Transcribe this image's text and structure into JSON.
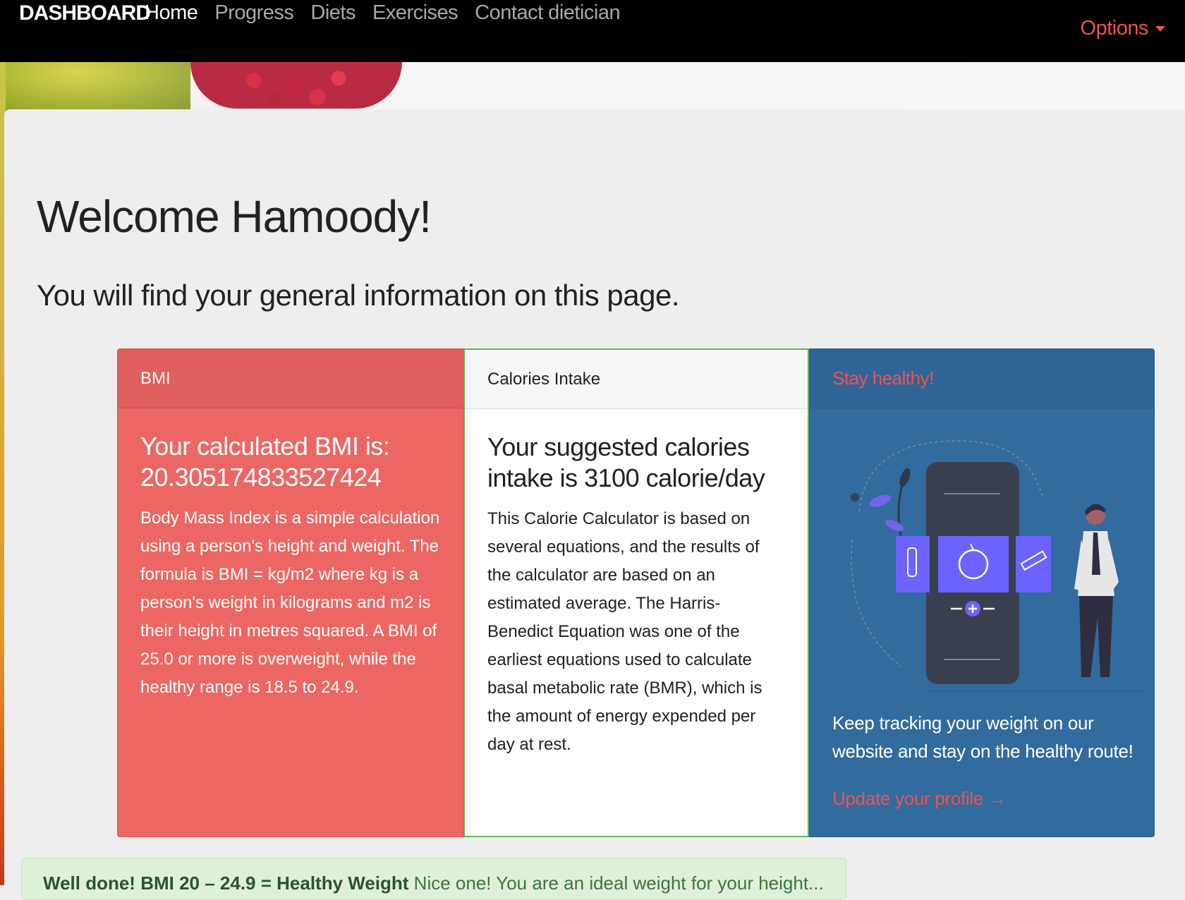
{
  "nav": {
    "brand": "DASHBOARD",
    "items": [
      {
        "label": "Home",
        "active": true
      },
      {
        "label": "Progress",
        "active": false
      },
      {
        "label": "Diets",
        "active": false
      },
      {
        "label": "Exercises",
        "active": false
      },
      {
        "label": "Contact dietician",
        "active": false
      }
    ],
    "options_label": "Options"
  },
  "main": {
    "welcome": "Welcome Hamoody!",
    "subtitle": "You will find your general information on this page."
  },
  "cards": {
    "bmi": {
      "header": "BMI",
      "title": "Your calculated BMI is: 20.305174833527424",
      "text": "Body Mass Index is a simple calculation using a person's height and weight. The formula is BMI = kg/m2 where kg is a person's weight in kilograms and m2 is their height in metres squared. A BMI of 25.0 or more is overweight, while the healthy range is 18.5 to 24.9."
    },
    "calories": {
      "header": "Calories Intake",
      "title": "Your suggested calories intake is 3100 calorie/day",
      "text": "This Calorie Calculator is based on several equations, and the results of the calculator are based on an estimated average. The Harris-Benedict Equation was one of the earliest equations used to calculate basal metabolic rate (BMR), which is the amount of energy expended per day at rest."
    },
    "health": {
      "header": "Stay healthy!",
      "text": "Keep tracking your weight on our website and stay on the healthy route!",
      "link": "Update your profile →"
    }
  },
  "alert": {
    "bold": "Well done! BMI 20 – 24.9 = Healthy Weight",
    "text": " Nice one! You are an ideal weight for your height..."
  },
  "colors": {
    "navbar": "#000000",
    "bmi_card": "#ec6763",
    "health_card": "#326b9e",
    "accent": "#ef5350"
  }
}
